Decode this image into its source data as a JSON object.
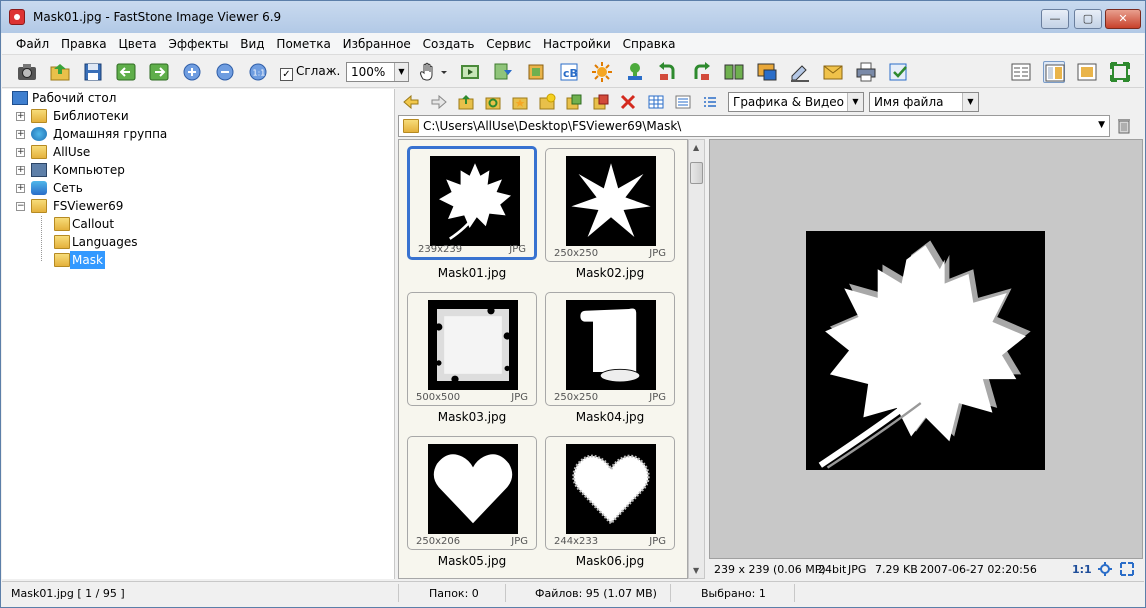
{
  "window": {
    "title": "Mask01.jpg  -  FastStone Image Viewer 6.9",
    "min": "—",
    "max": "▢",
    "close": "✕"
  },
  "menu": [
    "Файл",
    "Правка",
    "Цвета",
    "Эффекты",
    "Вид",
    "Пометка",
    "Избранное",
    "Создать",
    "Сервис",
    "Настройки",
    "Справка"
  ],
  "toolbar": {
    "smooth_label": "Сглаж.",
    "smooth_checked": "✓",
    "zoom_value": "100%"
  },
  "tree": {
    "root": "Рабочий стол",
    "items": [
      "Библиотеки",
      "Домашняя группа",
      "AllUse",
      "Компьютер",
      "Сеть",
      "FSViewer69"
    ],
    "children": [
      "Callout",
      "Languages",
      "Mask"
    ]
  },
  "browser": {
    "filter": "Графика & Видео",
    "sort": "Имя файла",
    "path": "C:\\Users\\AllUse\\Desktop\\FSViewer69\\Mask\\"
  },
  "thumbs": [
    {
      "name": "Mask01.jpg",
      "dim": "239x239",
      "ext": "JPG"
    },
    {
      "name": "Mask02.jpg",
      "dim": "250x250",
      "ext": "JPG"
    },
    {
      "name": "Mask03.jpg",
      "dim": "500x500",
      "ext": "JPG"
    },
    {
      "name": "Mask04.jpg",
      "dim": "250x250",
      "ext": "JPG"
    },
    {
      "name": "Mask05.jpg",
      "dim": "250x206",
      "ext": "JPG"
    },
    {
      "name": "Mask06.jpg",
      "dim": "244x233",
      "ext": "JPG"
    }
  ],
  "preview_info": {
    "size": "239 x 239 (0.06 MP)",
    "depth": "24bit",
    "format": "JPG",
    "filesize": "7.29 KB",
    "date": "2007-06-27 02:20:56",
    "ratio": "1:1"
  },
  "status": {
    "file": "Mask01.jpg [ 1 / 95 ]",
    "folders": "Папок: 0",
    "files": "Файлов: 95 (1.07 MB)",
    "selected": "Выбрано: 1"
  }
}
